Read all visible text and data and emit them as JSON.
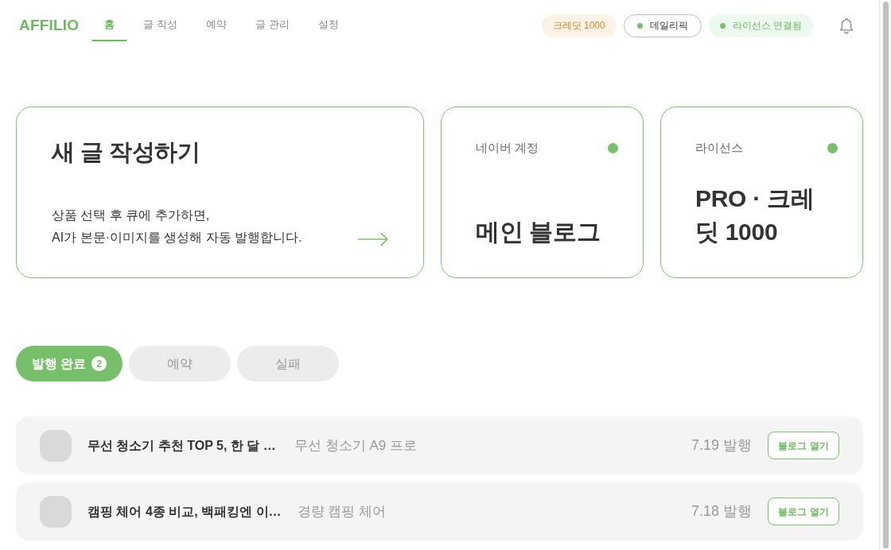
{
  "brand": "AFFILIO",
  "nav": [
    {
      "label": "홈",
      "selected": true
    },
    {
      "label": "글 작성",
      "selected": false
    },
    {
      "label": "예약",
      "selected": false
    },
    {
      "label": "글 관리",
      "selected": false
    },
    {
      "label": "설정",
      "selected": false
    }
  ],
  "header_badges": [
    {
      "kind": "credit",
      "label": "크레딧 1000"
    },
    {
      "kind": "status",
      "label": "데일리픽"
    },
    {
      "kind": "connected",
      "label": "라이선스 연결됨"
    }
  ],
  "new_post_card": {
    "title": "새 글 작성하기",
    "description": "상품 선택 후 큐에 추가하면,\nAI가 본문·이미지를 생성해 자동 발행합니다."
  },
  "status_cards": [
    {
      "label": "네이버 계정",
      "value": "메인 블로그",
      "active": true
    },
    {
      "label": "라이선스",
      "value": "PRO · 크레딧 1000",
      "active": true
    }
  ],
  "filter_tabs": [
    {
      "label": "발행 완료",
      "count": "2",
      "selected": true
    },
    {
      "label": "예약",
      "selected": false
    },
    {
      "label": "실패",
      "selected": false
    }
  ],
  "posts": [
    {
      "title": "무선 청소기 추천 TOP 5, 한 달 …",
      "product": "무선 청소기 A9 프로",
      "date": "7.19 발행",
      "action": "블로그 열기"
    },
    {
      "title": "캠핑 체어 4종 비교, 백패킹엔 이…",
      "product": "경량 캠핑 체어",
      "date": "7.18 발행",
      "action": "블로그 열기"
    }
  ]
}
